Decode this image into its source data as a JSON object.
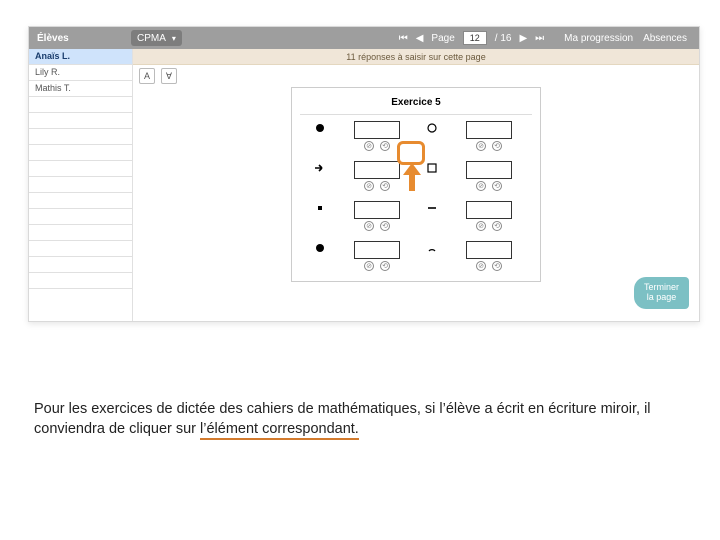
{
  "topbar": {
    "eleves_label": "Élèves",
    "class_label": "CPMA",
    "page_label": "Page",
    "page_value": "12",
    "page_total": "/ 16",
    "progression_label": "Ma progression",
    "absences_label": "Absences"
  },
  "sidebar": {
    "students": [
      "Anaïs L.",
      "Lily R.",
      "Mathis T."
    ],
    "selected_index": 0
  },
  "infobar": {
    "text": "11 réponses à saisir sur cette page"
  },
  "toolbar": {
    "btn_a": "A",
    "btn_mirror": "Ɐ"
  },
  "worksheet": {
    "title": "Exercice 5",
    "items": [
      {
        "shape": "circle-filled"
      },
      {
        "shape": "circle-outline"
      },
      {
        "shape": "arrow-right"
      },
      {
        "shape": "square-big"
      },
      {
        "shape": "square-small"
      },
      {
        "shape": "dash"
      },
      {
        "shape": "circle-filled"
      },
      {
        "shape": "half-circle"
      }
    ]
  },
  "controls": {
    "skip_glyph": "⊘",
    "mirror_glyph": "⟲"
  },
  "finish": {
    "line1": "Terminer",
    "line2": "la page"
  },
  "caption": {
    "part1": "Pour les exercices de dictée des cahiers de mathématiques, si l’élève a écrit en écriture miroir, il conviendra de cliquer sur ",
    "part2_underlined": "l’élément correspondant."
  }
}
